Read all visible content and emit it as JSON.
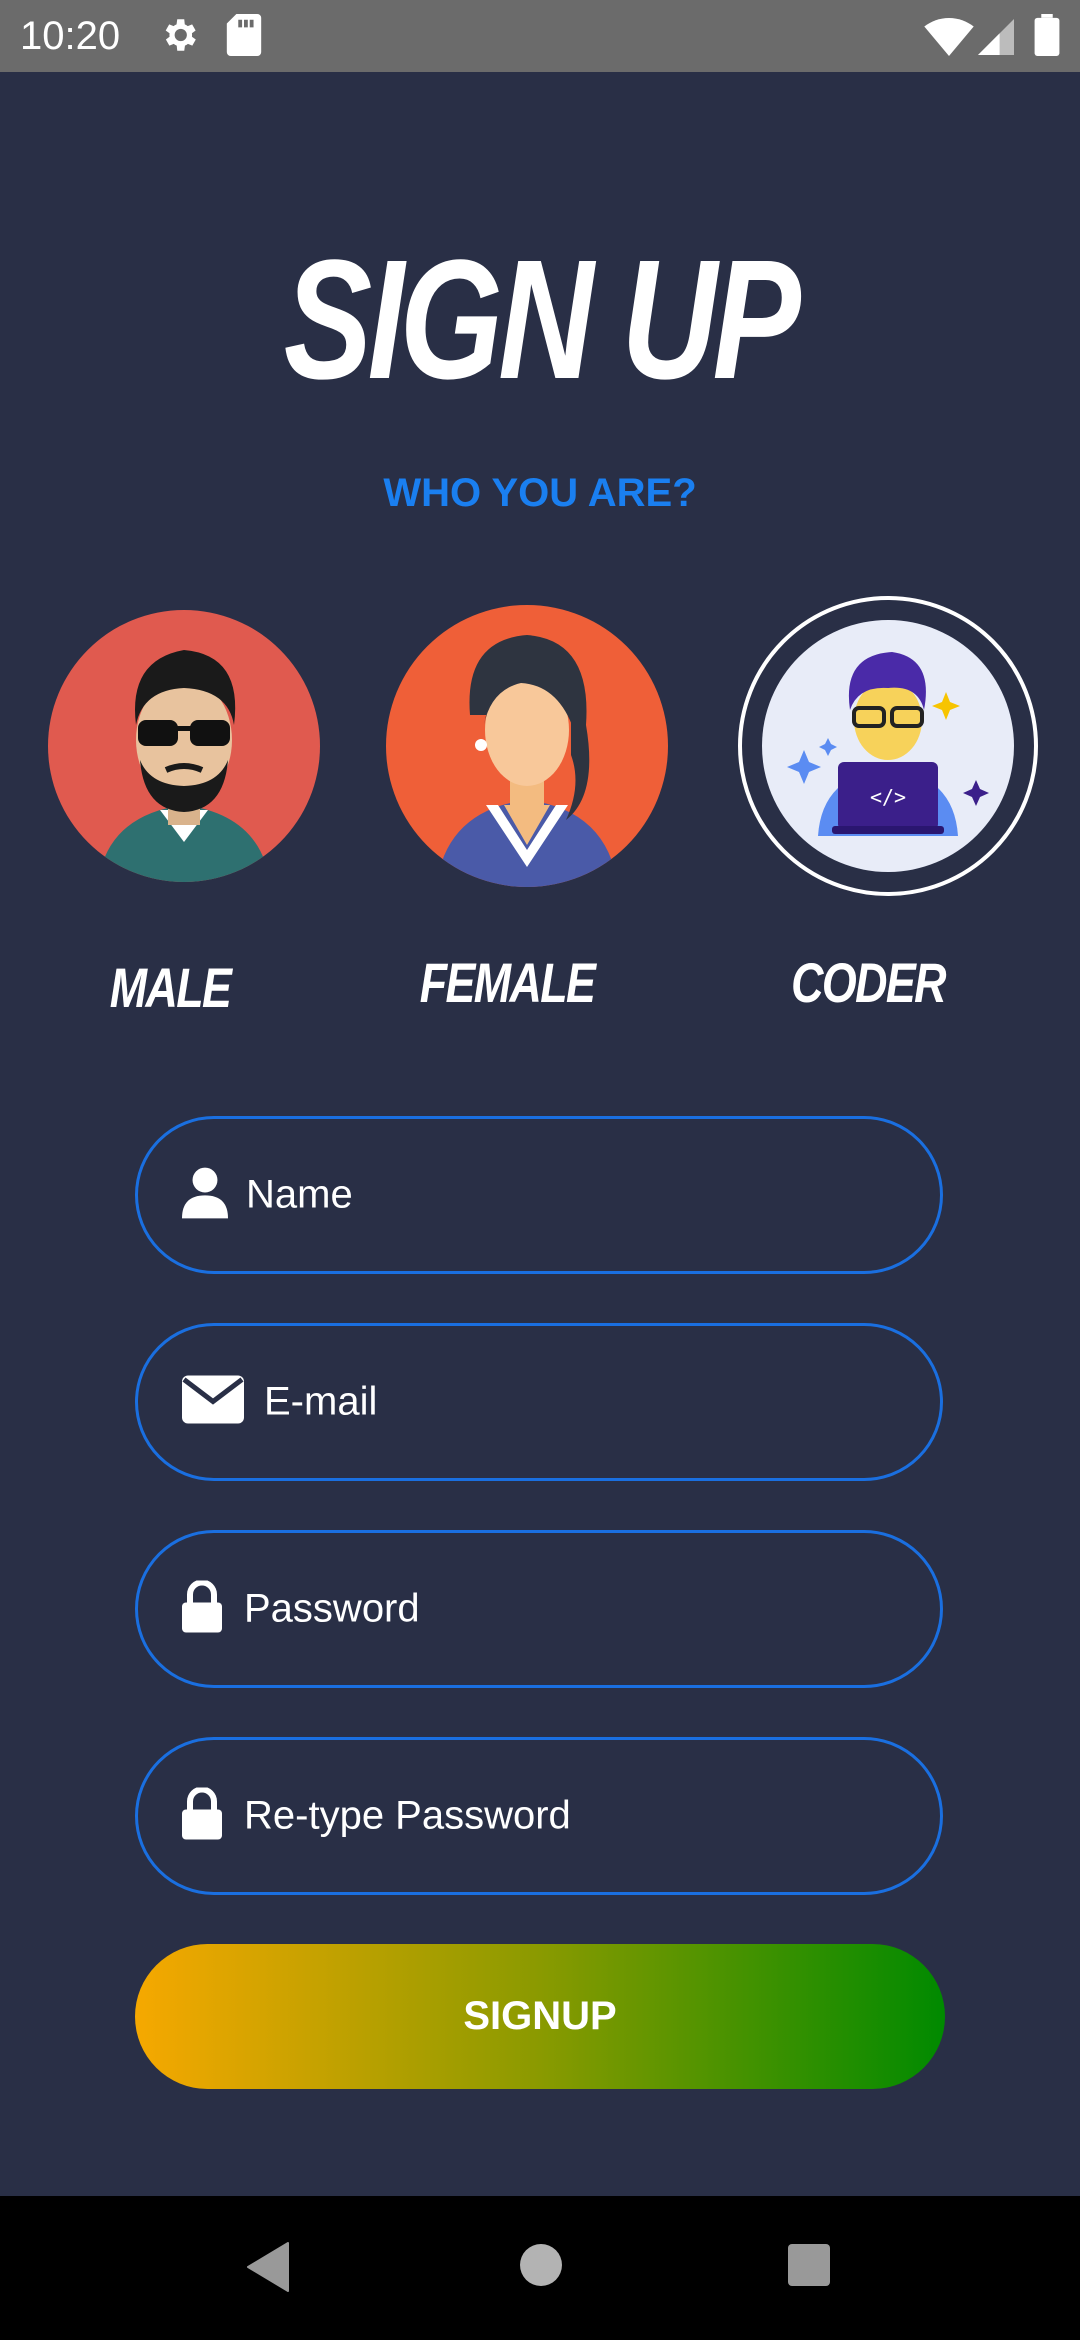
{
  "status_bar": {
    "time": "10:20",
    "icons": [
      "gear-icon",
      "sd-card-icon",
      "wifi-icon",
      "signal-icon",
      "battery-icon"
    ]
  },
  "title": "SIGN UP",
  "subtitle": "WHO YOU ARE?",
  "roles": [
    {
      "label": "MALE",
      "icon": "male-avatar-icon"
    },
    {
      "label": "FEMALE",
      "icon": "female-avatar-icon"
    },
    {
      "label": "CODER",
      "icon": "coder-avatar-icon",
      "selected": true
    }
  ],
  "fields": {
    "name": {
      "placeholder": "Name",
      "icon": "person-icon"
    },
    "email": {
      "placeholder": "E-mail",
      "icon": "envelope-icon"
    },
    "password": {
      "placeholder": "Password",
      "icon": "lock-icon"
    },
    "retype_password": {
      "placeholder": "Re-type Password",
      "icon": "lock-icon"
    }
  },
  "signup_button": {
    "label": "SIGNUP"
  },
  "nav_bar": {
    "icons": [
      "back-icon",
      "home-icon",
      "recents-icon"
    ]
  },
  "colors": {
    "background": "#292f46",
    "accent": "#1a7ff0",
    "button_gradient_start": "#f6a800",
    "button_gradient_end": "#008a00"
  }
}
